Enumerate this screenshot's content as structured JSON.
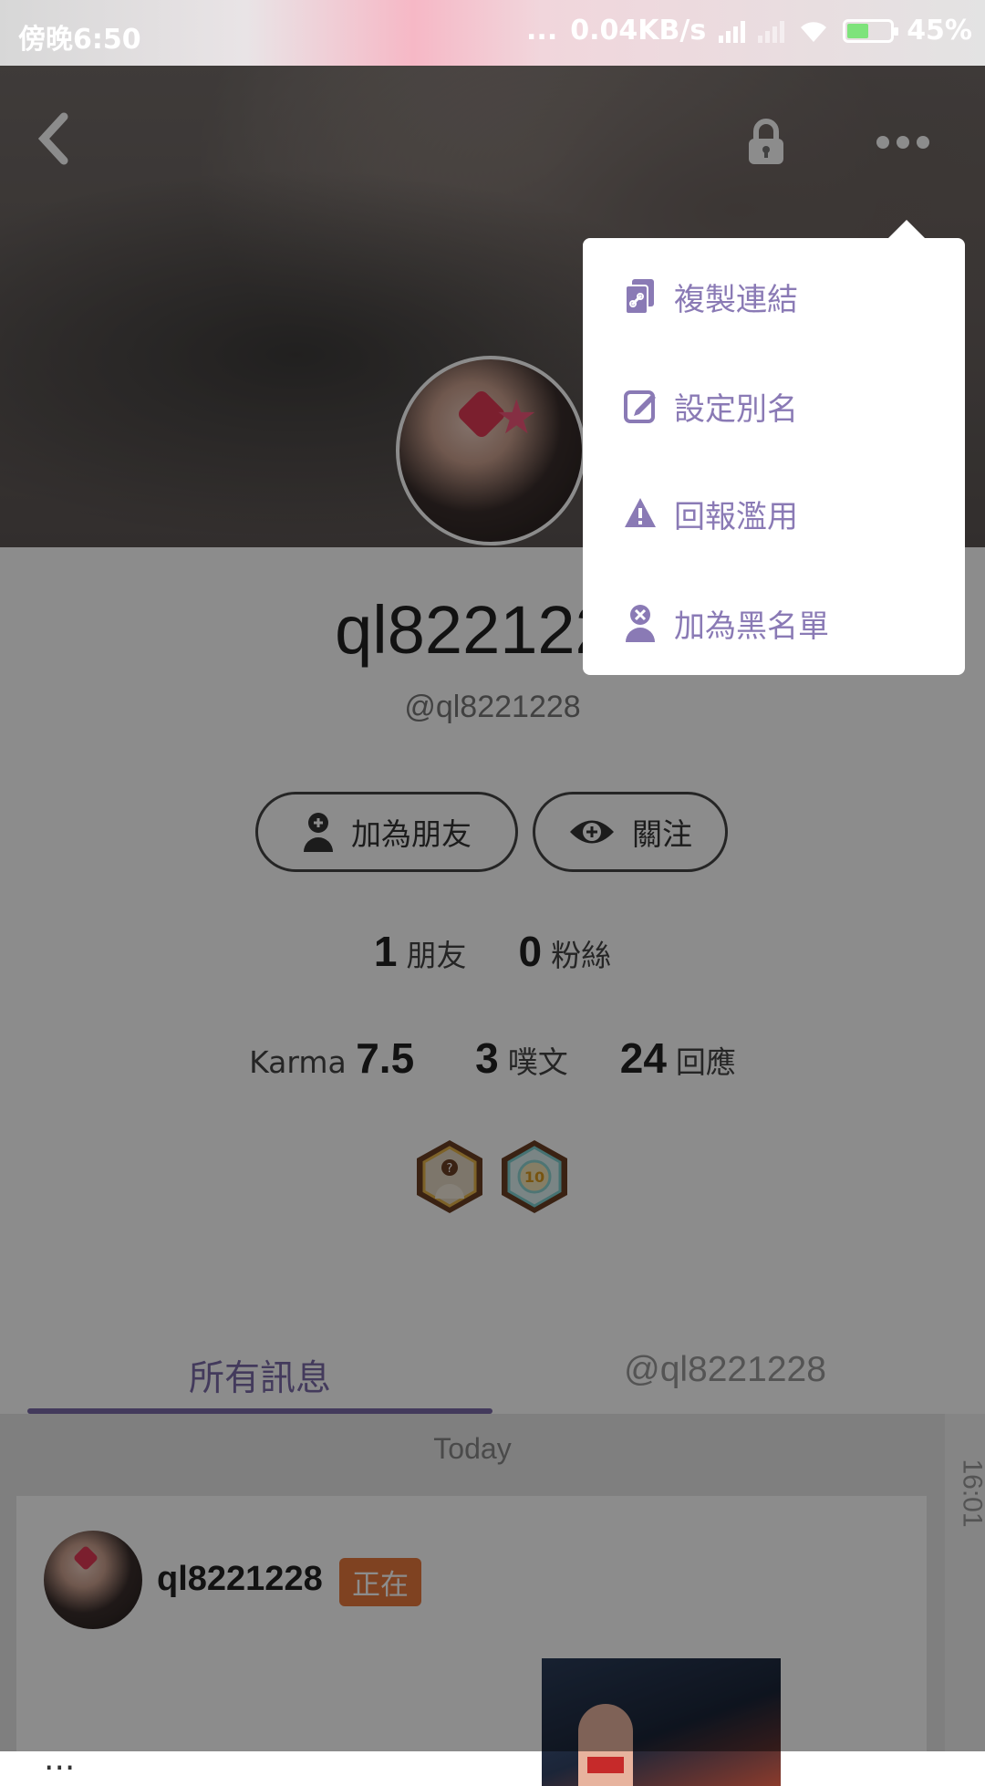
{
  "status_bar": {
    "time": "傍晚6:50",
    "network_speed": "0.04KB/s",
    "battery": "45%",
    "dots": "..."
  },
  "profile": {
    "display_name": "ql8221228",
    "handle": "@ql8221228",
    "add_friend_label": "加為朋友",
    "follow_label": "關注",
    "stats": {
      "friends_count": "1",
      "friends_label": "朋友",
      "fans_count": "0",
      "fans_label": "粉絲",
      "karma_label": "Karma",
      "karma_value": "7.5",
      "plurks_count": "3",
      "plurks_label": "噗文",
      "responses_count": "24",
      "responses_label": "回應"
    },
    "badges": [
      {
        "icon": "question-person-badge",
        "text": "?"
      },
      {
        "icon": "ten-badge",
        "text": "10"
      }
    ]
  },
  "tabs": {
    "all": "所有訊息",
    "mentions": "@ql8221228"
  },
  "feed": {
    "date_header": "Today",
    "side_time": "16:01",
    "post": {
      "author": "ql8221228",
      "tag": "正在",
      "text": "..."
    }
  },
  "menu": {
    "items": [
      {
        "label": "複製連結",
        "icon": "copy-link-icon"
      },
      {
        "label": "設定別名",
        "icon": "edit-icon"
      },
      {
        "label": "回報濫用",
        "icon": "warning-icon"
      },
      {
        "label": "加為黑名單",
        "icon": "block-user-icon"
      }
    ]
  },
  "colors": {
    "accent": "#8a7ab5",
    "tag": "#e8783c"
  }
}
